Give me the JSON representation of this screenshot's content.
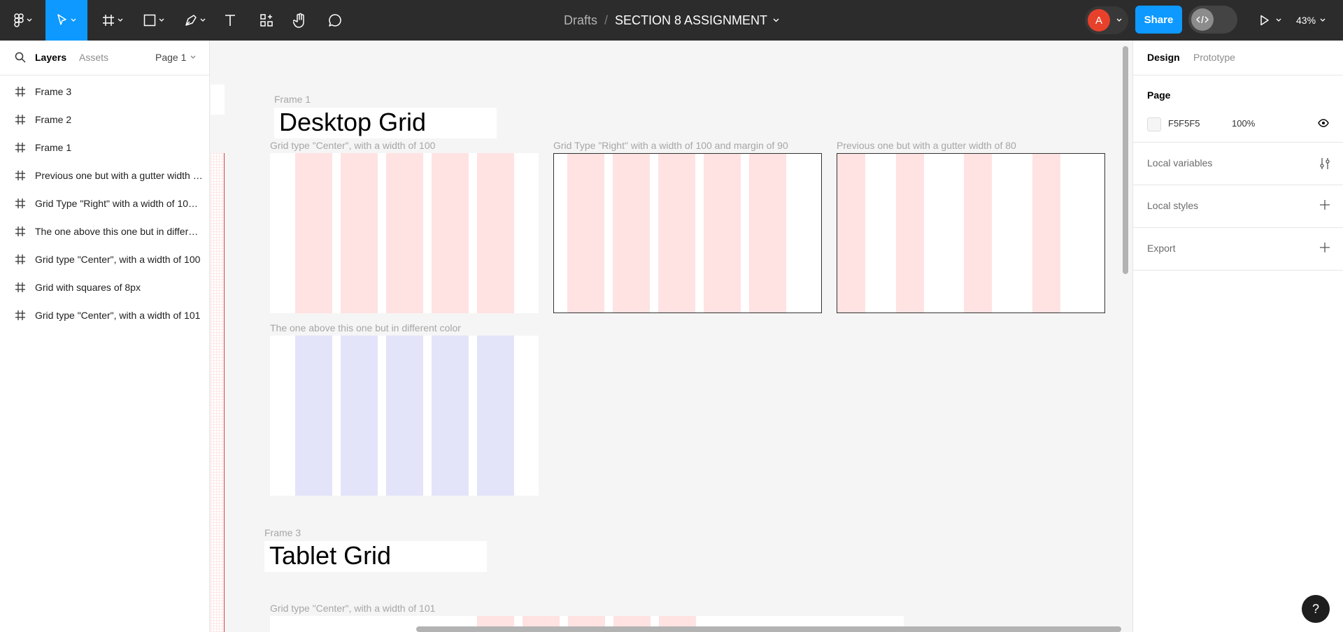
{
  "toolbar": {
    "breadcrumb_root": "Drafts",
    "breadcrumb_sep": "/",
    "file_name": "SECTION 8 ASSIGNMENT",
    "avatar_initial": "A",
    "share_label": "Share",
    "zoom_level": "43%"
  },
  "left_panel": {
    "tab_layers": "Layers",
    "tab_assets": "Assets",
    "page_selector": "Page 1",
    "layers": [
      "Frame 3",
      "Frame 2",
      "Frame 1",
      "Previous one but with a gutter width of 80",
      "Grid Type \"Right\" with a width of 100 and margin of 90",
      "The one above this one but in different color",
      "Grid type \"Center\", with a width of 100",
      "Grid with squares of 8px",
      "Grid type \"Center\", with a width of 101"
    ]
  },
  "canvas": {
    "frame1_label": "Frame 1",
    "frame1_title": "Desktop Grid",
    "grid1_label": "Grid type \"Center\", with a width of 100",
    "grid2_label": "Grid Type \"Right\" with a width of 100 and margin of 90",
    "grid3_label": "Previous one but with a gutter width of 80",
    "grid4_label": "The one above this one but in different color",
    "frame3_label": "Frame 3",
    "frame3_title": "Tablet Grid",
    "grid5_label": "Grid type \"Center\", with a width of 101"
  },
  "right_panel": {
    "tab_design": "Design",
    "tab_prototype": "Prototype",
    "page_title": "Page",
    "page_color": "F5F5F5",
    "page_opacity": "100%",
    "local_variables": "Local variables",
    "local_styles": "Local styles",
    "export": "Export"
  },
  "help": {
    "label": "?"
  },
  "colors": {
    "toolbar_bg": "#2c2c2c",
    "accent": "#0d99ff",
    "grid_red": "#ffe2e2",
    "grid_blue": "#e3e3f9",
    "avatar": "#e8412b"
  }
}
